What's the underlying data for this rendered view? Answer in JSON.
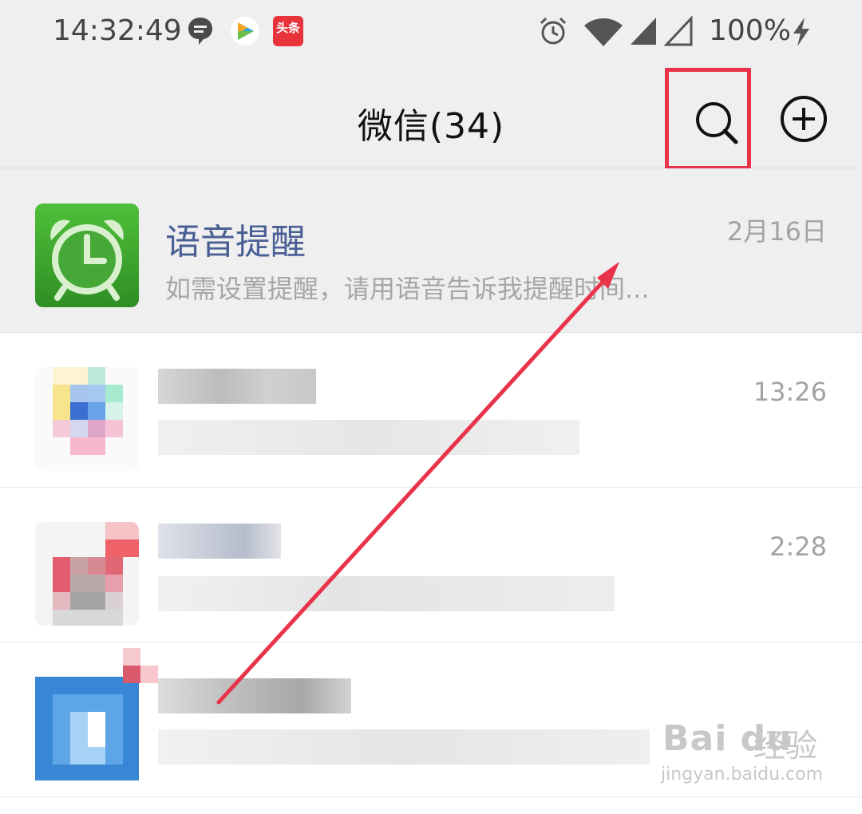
{
  "status_bar": {
    "time": "14:32:49",
    "battery": "100%",
    "app_badge": "头条",
    "icons": [
      "message-bubble-icon",
      "video-app-icon",
      "toutiao-icon",
      "alarm-icon",
      "wifi-icon",
      "signal-icon",
      "signal-empty-icon",
      "charging-icon"
    ]
  },
  "app_bar": {
    "title": "微信(34)",
    "search_icon": "search-icon",
    "add_icon": "plus-circle-icon",
    "highlight_color": "#e8334a"
  },
  "chats": [
    {
      "name": "语音提醒",
      "preview": "如需设置提醒，请用语音告诉我提醒时间...",
      "time": "2月16日",
      "avatar_icon": "alarm-clock-icon",
      "avatar_color": "#3aa02c"
    },
    {
      "time": "13:26",
      "blurred": true
    },
    {
      "time": "2:28",
      "blurred": true
    },
    {
      "time": "",
      "blurred": true
    }
  ],
  "annotation": {
    "arrow_color": "#e8334a"
  },
  "watermark": {
    "logo": "Bai du",
    "jingyan": "经验",
    "url": "jingyan.baidu.com"
  }
}
